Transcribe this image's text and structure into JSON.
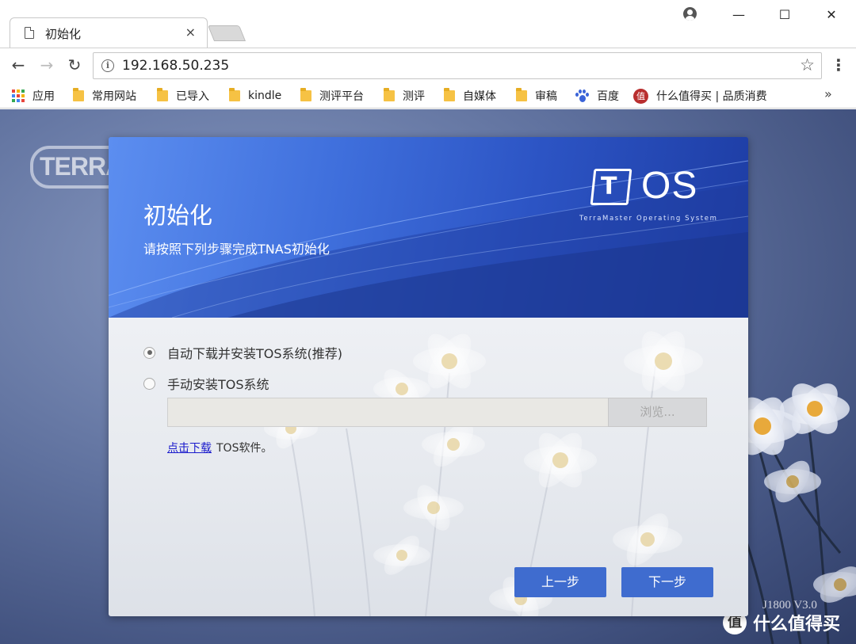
{
  "browser": {
    "tab_title": "初始化",
    "tab_close": "×",
    "url": "192.168.50.235",
    "window_controls": {
      "minimize": "—",
      "maximize": "☐",
      "close": "✕"
    },
    "nav": {
      "back": "←",
      "forward": "→",
      "reload": "↻",
      "star": "☆",
      "menu": "⋮"
    },
    "bookmarks": [
      {
        "label": "应用",
        "icon": "apps-grid-icon"
      },
      {
        "label": "常用网站",
        "icon": "folder-icon"
      },
      {
        "label": "已导入",
        "icon": "folder-icon"
      },
      {
        "label": "kindle",
        "icon": "folder-icon"
      },
      {
        "label": "测评平台",
        "icon": "folder-icon"
      },
      {
        "label": "测评",
        "icon": "folder-icon"
      },
      {
        "label": "自媒体",
        "icon": "folder-icon"
      },
      {
        "label": "审稿",
        "icon": "folder-icon"
      },
      {
        "label": "百度",
        "icon": "baidu-paw-icon"
      },
      {
        "label": "什么值得买 | 品质消费",
        "icon": "smzdm-icon",
        "icon_text": "值"
      }
    ],
    "bookmarks_more": "»"
  },
  "page": {
    "brand_logo_text": "TERRAMASTER",
    "version": "J1800 V3.0",
    "watermark": {
      "icon_text": "值",
      "text": "什么值得买"
    }
  },
  "dialog": {
    "title": "初始化",
    "subtitle": "请按照下列步骤完成TNAS初始化",
    "logo": {
      "box_letter": "T",
      "text": "OS",
      "caption": "TerraMaster Operating System"
    },
    "options": [
      {
        "label": "自动下载并安装TOS系统(推荐)",
        "checked": true
      },
      {
        "label": "手动安装TOS系统",
        "checked": false
      }
    ],
    "file_input_value": "",
    "browse_label": "浏览...",
    "download_link": "点击下载",
    "download_suffix": "TOS软件。",
    "prev_label": "上一步",
    "next_label": "下一步",
    "colors": {
      "header_blue": "#3f6fdc",
      "button_blue": "#3f6ccf",
      "link": "#1a1acc"
    }
  }
}
